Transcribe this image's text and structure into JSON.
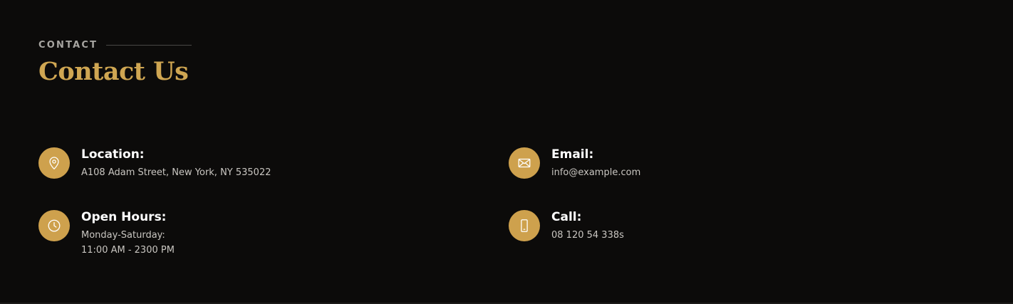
{
  "section": {
    "eyebrow": "CONTACT",
    "title": "Contact Us"
  },
  "items": {
    "location": {
      "label": "Location:",
      "value": "A108 Adam Street, New York, NY 535022",
      "icon": "map-pin-icon"
    },
    "email": {
      "label": "Email:",
      "value": "info@example.com",
      "icon": "envelope-icon"
    },
    "hours": {
      "label": "Open Hours:",
      "value_line1": "Monday-Saturday:",
      "value_line2": "11:00 AM - 2300 PM",
      "icon": "clock-icon"
    },
    "call": {
      "label": "Call:",
      "value": "08 120 54 338s",
      "icon": "phone-icon"
    }
  },
  "colors": {
    "background": "#0c0b0a",
    "accent": "#cfa652",
    "icon_bg": "#cea14d",
    "label": "#ffffff",
    "value": "#c9c6c1"
  }
}
